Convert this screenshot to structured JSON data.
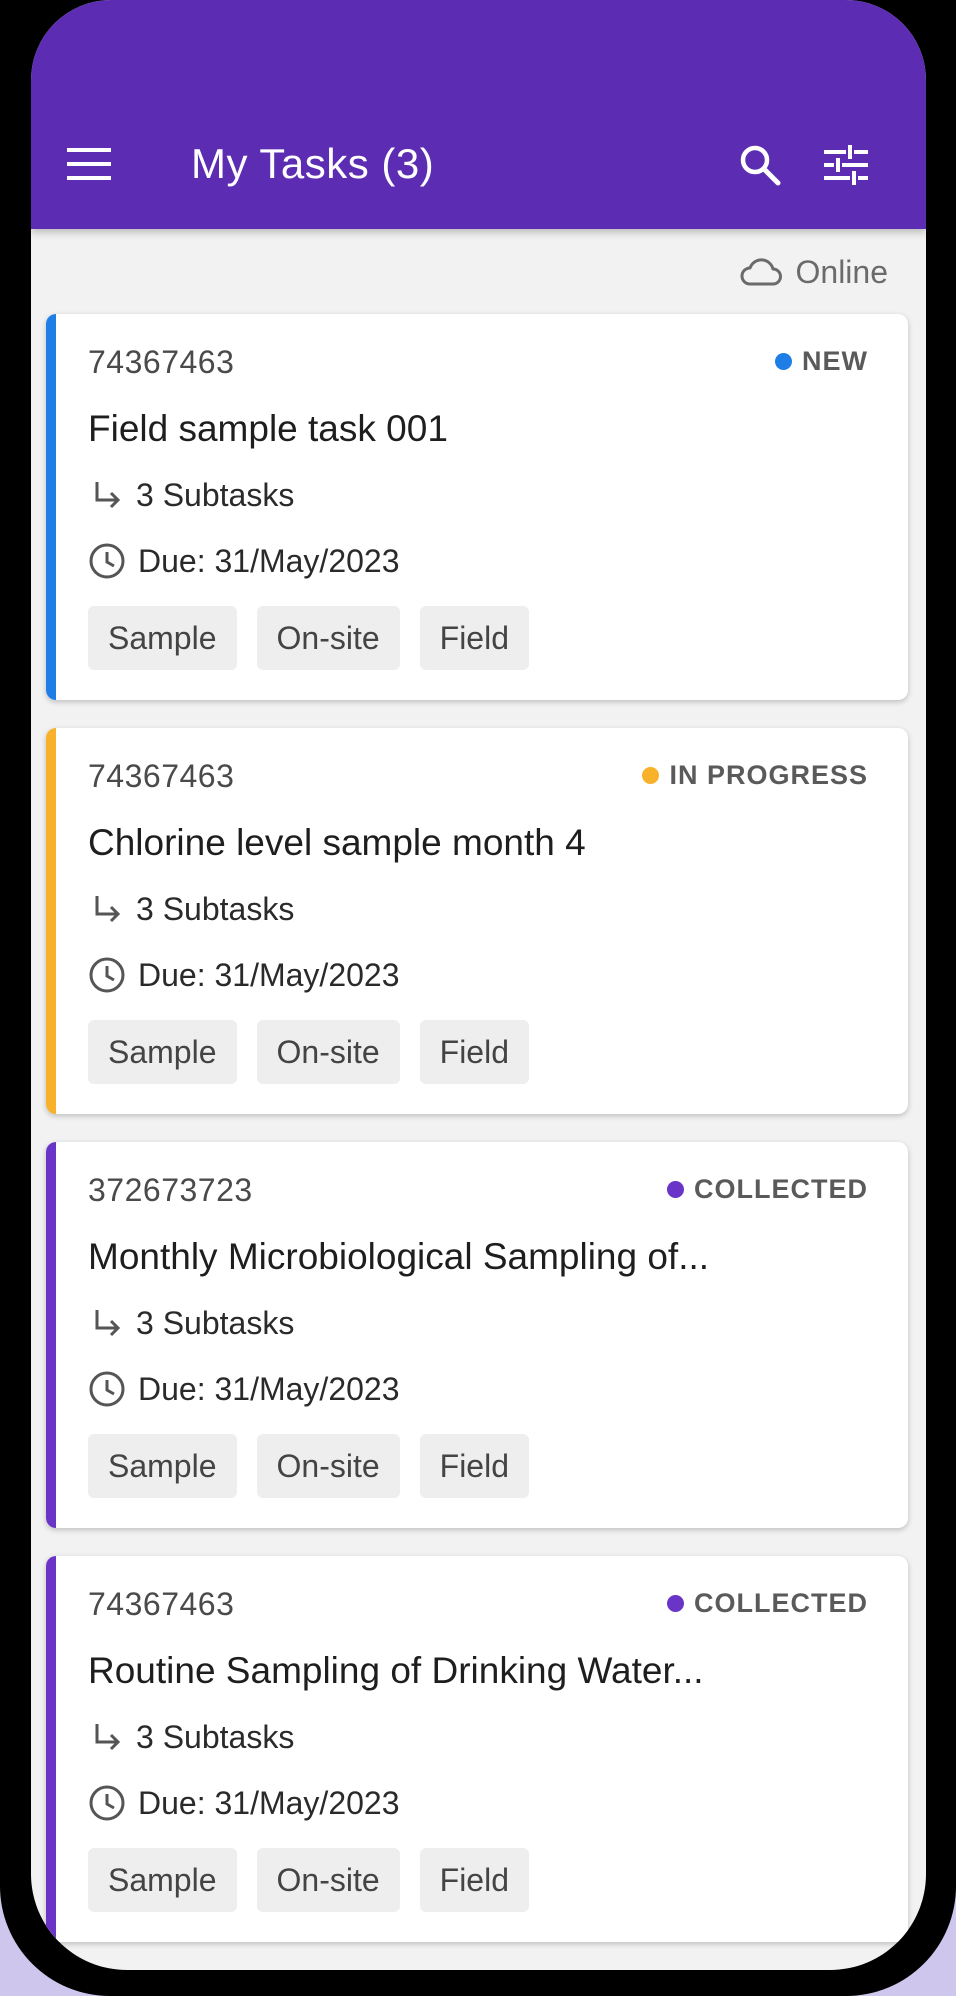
{
  "app": {
    "title": "My Tasks (3)",
    "colors": {
      "app_bar": "#5c2db3",
      "new": "#1e7ee6",
      "in_progress": "#f8b12a",
      "collected": "#6a35c7"
    }
  },
  "toolbar": {
    "menu_icon": "menu-icon",
    "search_icon": "search-icon",
    "filter_icon": "tune-icon"
  },
  "connection": {
    "label": "Online",
    "icon": "cloud-icon"
  },
  "tasks": [
    {
      "id": "74367463",
      "status": "NEW",
      "status_color": "#1e7ee6",
      "title": "Field sample task 001",
      "subtasks": "3 Subtasks",
      "due": "Due: 31/May/2023",
      "tags": [
        "Sample",
        "On-site",
        "Field"
      ]
    },
    {
      "id": "74367463",
      "status": "IN PROGRESS",
      "status_color": "#f8b12a",
      "title": "Chlorine level sample month 4",
      "subtasks": "3 Subtasks",
      "due": "Due: 31/May/2023",
      "tags": [
        "Sample",
        "On-site",
        "Field"
      ]
    },
    {
      "id": "372673723",
      "status": "COLLECTED",
      "status_color": "#6a35c7",
      "title": "Monthly Microbiological Sampling of...",
      "subtasks": "3 Subtasks",
      "due": "Due: 31/May/2023",
      "tags": [
        "Sample",
        "On-site",
        "Field"
      ]
    },
    {
      "id": "74367463",
      "status": "COLLECTED",
      "status_color": "#6a35c7",
      "title": "Routine Sampling of Drinking Water...",
      "subtasks": "3 Subtasks",
      "due": "Due: 31/May/2023",
      "tags": [
        "Sample",
        "On-site",
        "Field"
      ]
    }
  ]
}
